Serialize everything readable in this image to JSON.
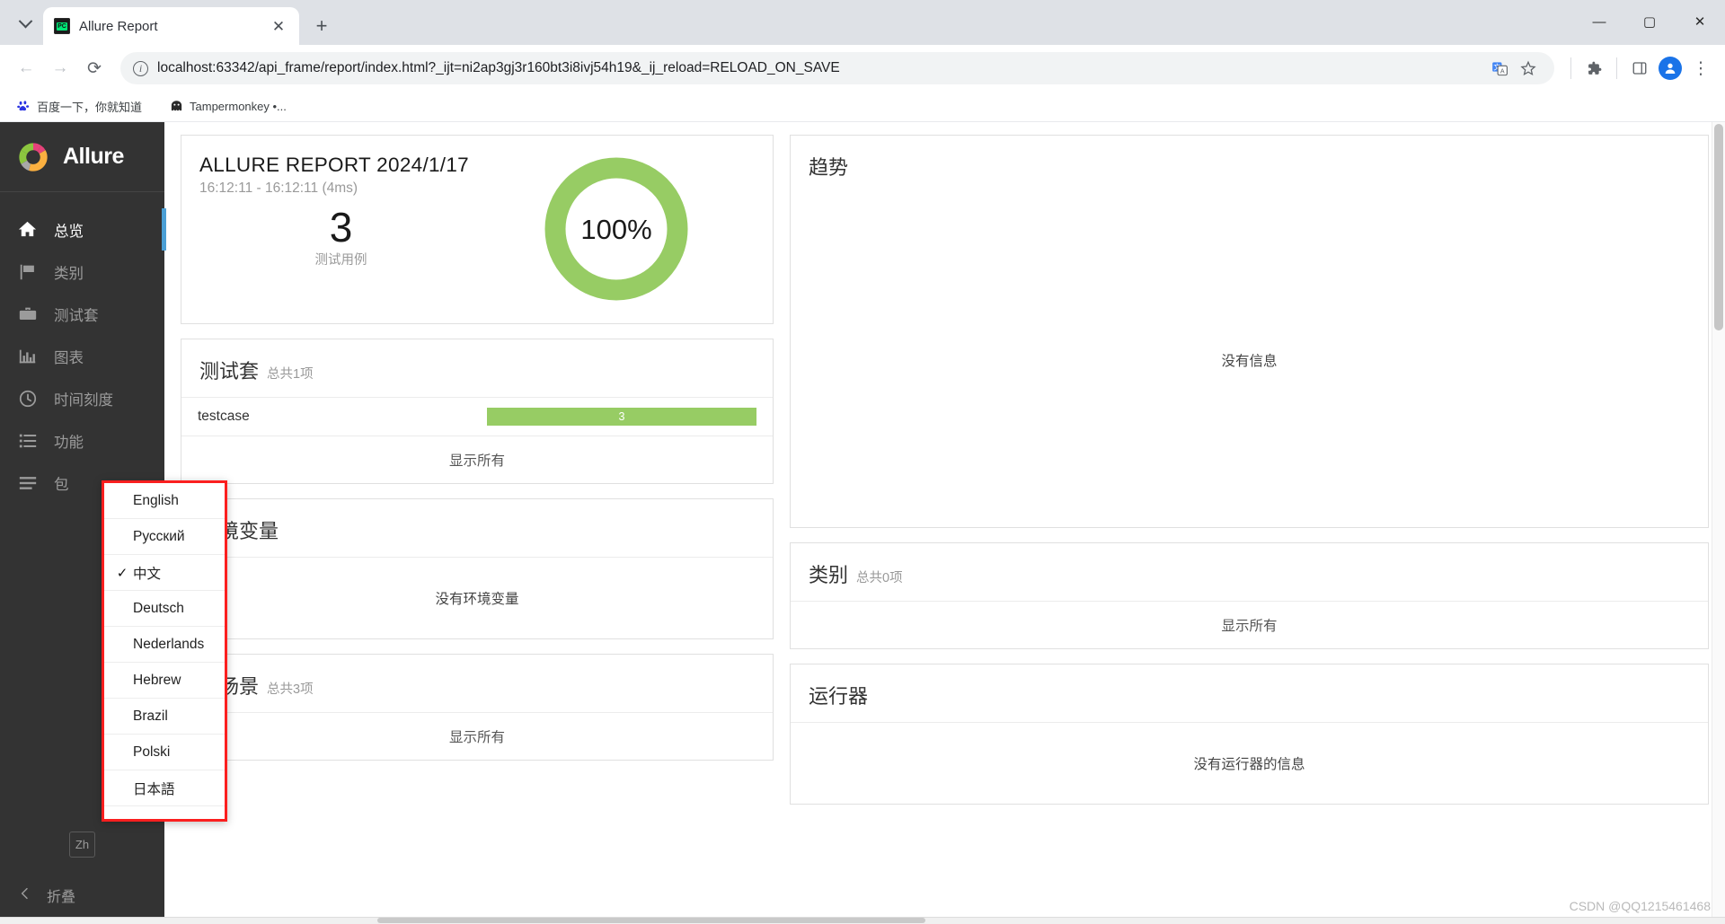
{
  "browser": {
    "tab": {
      "title": "Allure Report",
      "favicon_label": "PC",
      "close_label": "✕"
    },
    "new_tab_label": "+",
    "tab_list_icon": "chevron-down-icon",
    "window": {
      "minimize": "—",
      "maximize": "▢",
      "close": "✕"
    },
    "nav": {
      "back": "←",
      "forward": "→",
      "reload": "⟳"
    },
    "omnibox": {
      "url": "localhost:63342/api_frame/report/index.html?_ijt=ni2ap3gj3r160bt3i8ivj54h19&_ij_reload=RELOAD_ON_SAVE",
      "info_icon": "ⓘ",
      "translate_icon": "translate-icon",
      "bookmark_icon": "★"
    },
    "toolbar_right": {
      "extensions_icon": "puzzle-icon",
      "sidepanel_icon": "side-panel-icon",
      "profile_icon": "account-icon",
      "menu_icon": "⋮"
    },
    "bookmarks": [
      {
        "label": "百度一下，你就知道",
        "icon": "baidu-icon"
      },
      {
        "label": "Tampermonkey •...",
        "icon": "tampermonkey-icon"
      }
    ]
  },
  "sidebar": {
    "brand": "Allure",
    "items": [
      {
        "label": "总览",
        "icon": "home-icon",
        "active": true
      },
      {
        "label": "类别",
        "icon": "flag-icon",
        "active": false
      },
      {
        "label": "测试套",
        "icon": "briefcase-icon",
        "active": false
      },
      {
        "label": "图表",
        "icon": "bar-chart-icon",
        "active": false
      },
      {
        "label": "时间刻度",
        "icon": "clock-icon",
        "active": false
      },
      {
        "label": "功能",
        "icon": "list-icon",
        "active": false
      },
      {
        "label": "包",
        "icon": "package-icon",
        "active": false
      }
    ],
    "language_badge": "Zh",
    "collapse_label": "折叠",
    "collapse_icon": "chevron-left-icon"
  },
  "language_menu": {
    "items": [
      {
        "label": "English",
        "checked": false
      },
      {
        "label": "Русский",
        "checked": false
      },
      {
        "label": "中文",
        "checked": true
      },
      {
        "label": "Deutsch",
        "checked": false
      },
      {
        "label": "Nederlands",
        "checked": false
      },
      {
        "label": "Hebrew",
        "checked": false
      },
      {
        "label": "Brazil",
        "checked": false
      },
      {
        "label": "Polski",
        "checked": false
      },
      {
        "label": "日本語",
        "checked": false
      }
    ],
    "check_glyph": "✓",
    "border_color": "#fb1f1f"
  },
  "summary": {
    "title": "ALLURE REPORT 2024/1/17",
    "time_range": "16:12:11 - 16:12:11 (4ms)",
    "test_count": "3",
    "test_count_label": "测试用例",
    "pass_percent": "100%",
    "pass_color": "#97cc64"
  },
  "suites": {
    "title": "测试套",
    "subtitle": "总共1项",
    "rows": [
      {
        "name": "testcase",
        "count": "3",
        "color": "#97cc64"
      }
    ],
    "show_all": "显示所有"
  },
  "environment": {
    "title": "环境变量",
    "empty": "没有环境变量"
  },
  "scenarios": {
    "title": "主场景",
    "subtitle": "总共3项",
    "show_all": "显示所有"
  },
  "trend": {
    "title": "趋势",
    "empty": "没有信息"
  },
  "categories": {
    "title": "类别",
    "subtitle": "总共0项",
    "show_all": "显示所有"
  },
  "executors": {
    "title": "运行器",
    "empty": "没有运行器的信息"
  },
  "watermark": "CSDN @QQ1215461468"
}
